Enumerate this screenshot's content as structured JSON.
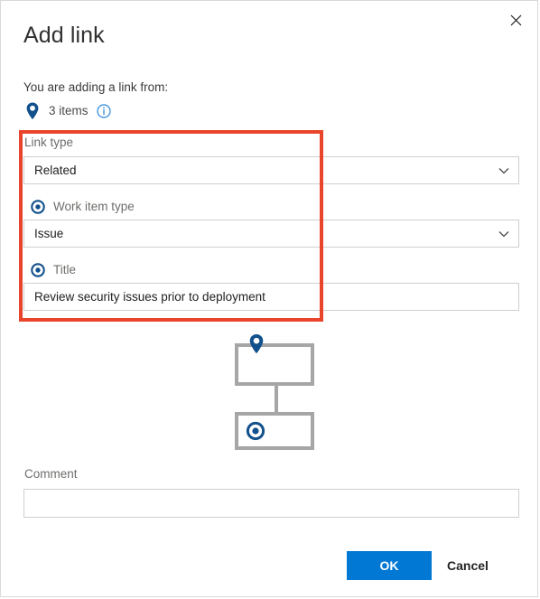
{
  "dialog": {
    "title": "Add link",
    "close_icon": "close-icon",
    "source_label": "You are adding a link from:",
    "source_items": {
      "pin_icon": "map-pin-icon",
      "count_label": "3 items",
      "info_icon": "info-circle-icon"
    },
    "highlight_color": "#e8452c"
  },
  "form": {
    "link_type": {
      "label": "Link type",
      "value": "Related",
      "chevron_icon": "chevron-down-icon"
    },
    "work_item_type": {
      "label": "Work item type",
      "radio_icon": "radio-selected-icon",
      "value": "Issue",
      "chevron_icon": "chevron-down-icon"
    },
    "title_field": {
      "label": "Title",
      "radio_icon": "radio-selected-icon",
      "value": "Review security issues prior to deployment",
      "placeholder": ""
    },
    "comment": {
      "label": "Comment",
      "value": "",
      "placeholder": ""
    }
  },
  "diagram": {
    "parent_icon": "map-pin-icon",
    "child_icon": "radio-selected-icon",
    "node_border_color": "#a6a6a6"
  },
  "footer": {
    "ok_label": "OK",
    "cancel_label": "Cancel",
    "primary_color": "#0078d4"
  }
}
